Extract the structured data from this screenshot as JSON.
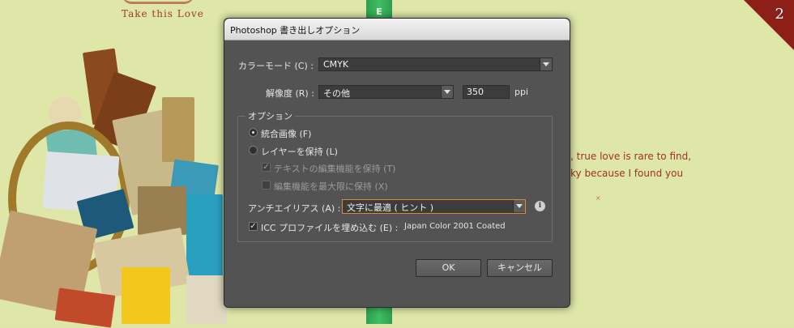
{
  "background": {
    "title": "Take this Love",
    "stripe_mark": "E",
    "corner_number": "2",
    "poem_line1": ", true love is rare to find,",
    "poem_line2": "ky because I found you",
    "dot": "×"
  },
  "dialog": {
    "title": "Photoshop 書き出しオプション",
    "color_mode_label": "カラーモード (C) :",
    "color_mode_value": "CMYK",
    "resolution_label": "解像度 (R) :",
    "resolution_value": "その他",
    "resolution_number": "350",
    "resolution_unit": "ppi",
    "options_title": "オプション",
    "flatten_label": "統合画像 (F)",
    "keep_layers_label": "レイヤーを保持 (L)",
    "preserve_text_label": "テキストの編集機能を保持 (T)",
    "max_edit_label": "編集機能を最大限に保持 (X)",
    "antialias_label": "アンチエイリアス (A) :",
    "antialias_value": "文字に最適 ( ヒント )",
    "info_icon": "i",
    "icc_label": "ICC プロファイルを埋め込む (E) :",
    "icc_value": "Japan Color 2001 Coated",
    "ok_label": "OK",
    "cancel_label": "キャンセル"
  },
  "colors": {
    "background": "#dee7a8",
    "stripe": "#2d9f4f",
    "corner": "#8c1f17",
    "dialog": "#535353",
    "focus_border": "#d98c2e"
  }
}
